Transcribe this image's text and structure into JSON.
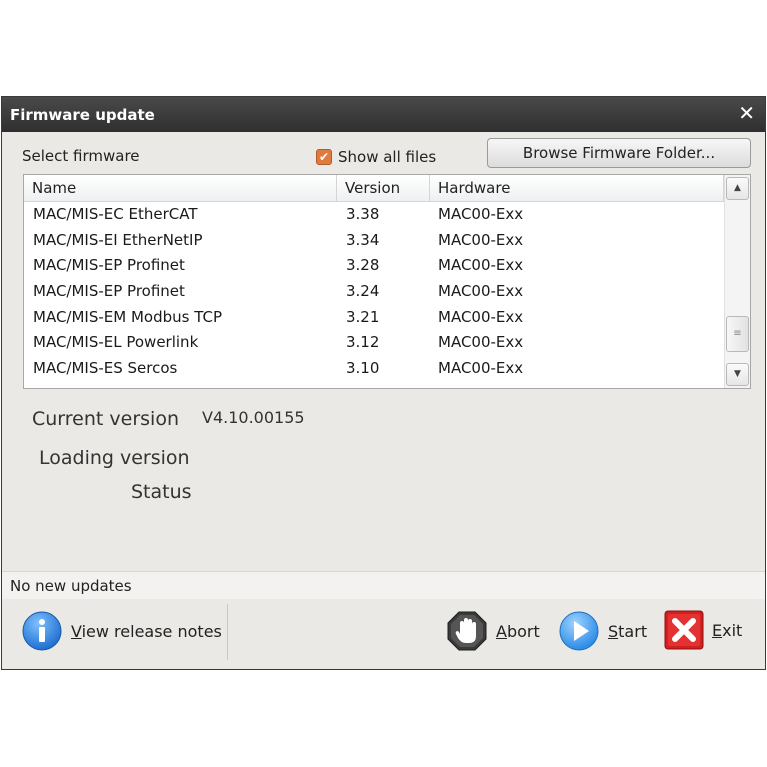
{
  "window": {
    "title": "Firmware update"
  },
  "select": {
    "label": "Select firmware",
    "show_all_label": "Show all files",
    "show_all_checked": true,
    "browse_label": "Browse Firmware Folder..."
  },
  "table": {
    "columns": [
      "Name",
      "Version",
      "Hardware"
    ],
    "rows": [
      {
        "name": "MAC/MIS-EC EtherCAT",
        "version": "3.38",
        "hardware": "MAC00-Exx"
      },
      {
        "name": "MAC/MIS-EI EtherNetIP",
        "version": "3.34",
        "hardware": "MAC00-Exx"
      },
      {
        "name": "MAC/MIS-EP Profinet",
        "version": "3.28",
        "hardware": "MAC00-Exx"
      },
      {
        "name": "MAC/MIS-EP Profinet",
        "version": "3.24",
        "hardware": "MAC00-Exx"
      },
      {
        "name": "MAC/MIS-EM Modbus TCP",
        "version": "3.21",
        "hardware": "MAC00-Exx"
      },
      {
        "name": "MAC/MIS-EL Powerlink",
        "version": "3.12",
        "hardware": "MAC00-Exx"
      },
      {
        "name": "MAC/MIS-ES Sercos",
        "version": "3.10",
        "hardware": "MAC00-Exx"
      }
    ]
  },
  "info": {
    "current_label": "Current version",
    "current_value": "V4.10.00155",
    "loading_label": "Loading version",
    "status_label": "Status"
  },
  "statusbar": {
    "text": "No new updates"
  },
  "actions": {
    "release_notes_prefix": "V",
    "release_notes_rest": "iew release notes",
    "abort_prefix": "A",
    "abort_rest": "bort",
    "start_prefix": "S",
    "start_rest": "tart",
    "exit_prefix": "E",
    "exit_rest": "xit"
  },
  "colors": {
    "titlebar": "#2f2f2f",
    "window_bg": "#ebe9e6",
    "checkbox": "#e07a3f",
    "info_icon": "#1f6fd0",
    "start_icon": "#2a8be6",
    "exit_icon": "#d21f1f"
  },
  "icons": {
    "close": "close-icon",
    "info": "info-icon",
    "abort": "stop-hand-icon",
    "start": "play-icon",
    "exit": "exit-x-icon"
  }
}
